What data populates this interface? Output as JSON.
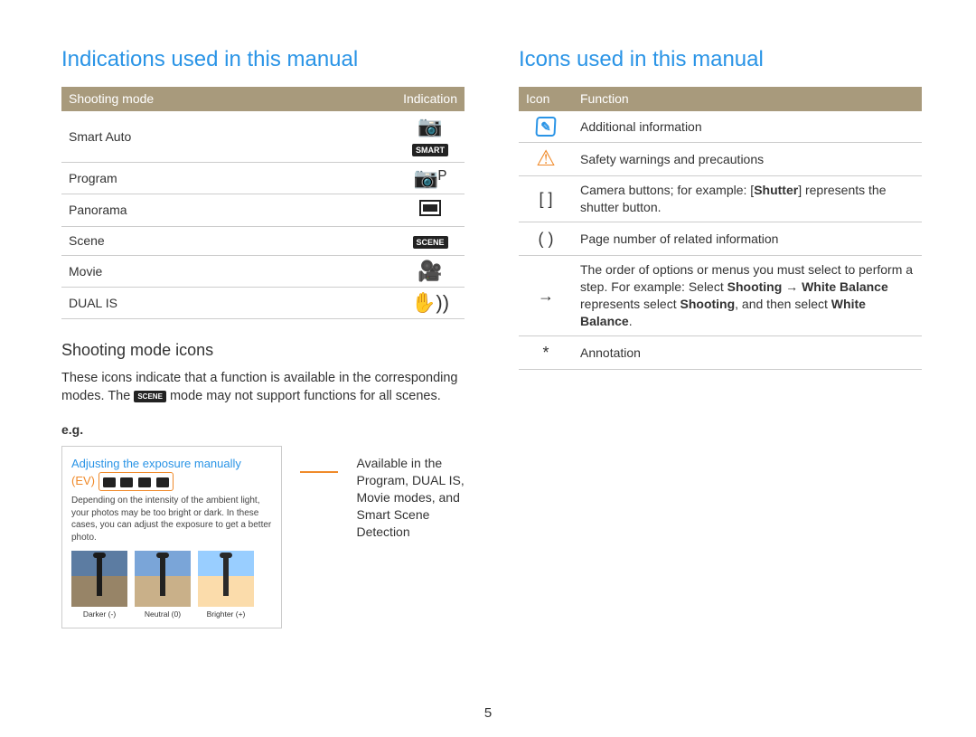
{
  "left": {
    "heading": "Indications used in this manual",
    "table": {
      "head": [
        "Shooting mode",
        "Indication"
      ],
      "rows": [
        {
          "mode": "Smart Auto",
          "icon": "camera-smart-icon",
          "iconLabel": "SMART"
        },
        {
          "mode": "Program",
          "icon": "camera-p-icon",
          "iconText": "📷ᴾ"
        },
        {
          "mode": "Panorama",
          "icon": "panorama-icon"
        },
        {
          "mode": "Scene",
          "icon": "scene-icon",
          "iconLabel": "SCENE"
        },
        {
          "mode": "Movie",
          "icon": "movie-icon",
          "iconText": "🎥"
        },
        {
          "mode": "DUAL IS",
          "icon": "dual-is-icon",
          "iconText": "✋))"
        }
      ]
    },
    "sub_heading": "Shooting mode icons",
    "desc_before": "These icons indicate that a function is available in the corresponding modes. The ",
    "desc_inline_icon_label": "SCENE",
    "desc_after": " mode may not support functions for all scenes.",
    "eg_label": "e.g.",
    "eg_box": {
      "title": "Adjusting the exposure manually",
      "subtitle_prefix": "(EV)",
      "body": "Depending on the intensity of the ambient light, your photos may be too bright or dark. In these cases, you can adjust the exposure to get a better photo.",
      "thumbs": [
        {
          "caption": "Darker (-)"
        },
        {
          "caption": "Neutral (0)"
        },
        {
          "caption": "Brighter (+)"
        }
      ]
    },
    "eg_callout": "Available in the\nProgram, DUAL IS,\nMovie modes, and\nSmart Scene Detection"
  },
  "right": {
    "heading": "Icons used in this manual",
    "table": {
      "head": [
        "Icon",
        "Function"
      ],
      "rows": [
        {
          "icon": "info-icon",
          "fn_plain": "Additional information"
        },
        {
          "icon": "warning-icon",
          "fn_plain": "Safety warnings and precautions"
        },
        {
          "icon": "brackets-icon",
          "iconText": "[  ]",
          "fn_html": "Camera buttons; for example: [<b>Shutter</b>] represents the shutter button."
        },
        {
          "icon": "parens-icon",
          "iconText": "(  )",
          "fn_plain": "Page number of related information"
        },
        {
          "icon": "arrow-icon",
          "iconText": "→",
          "fn_html": "The order of options or menus you must select to perform a step. For example: Select <b>Shooting → White Balance</b> represents select <b>Shooting</b>, and then select <b>White Balance</b>."
        },
        {
          "icon": "asterisk-icon",
          "iconText": "*",
          "fn_plain": "Annotation"
        }
      ]
    }
  },
  "page_number": "5"
}
